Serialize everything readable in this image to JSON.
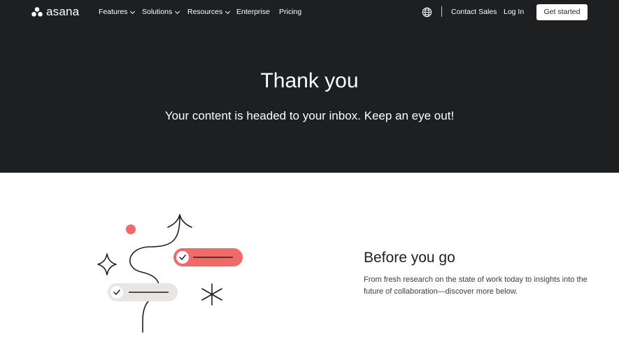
{
  "nav": {
    "logo_text": "asana",
    "features": "Features",
    "solutions": "Solutions",
    "resources": "Resources",
    "enterprise": "Enterprise",
    "pricing": "Pricing",
    "contact_sales": "Contact Sales",
    "log_in": "Log In",
    "get_started": "Get started"
  },
  "hero": {
    "title": "Thank you",
    "subtitle": "Your content is headed to your inbox. Keep an eye out!"
  },
  "before_you_go": {
    "title": "Before you go",
    "body": "From fresh research on the state of work today to insights into the future of collaboration—discover more below."
  },
  "colors": {
    "hero_bg": "#1e1f21",
    "accent_coral": "#f06a6a",
    "pill_grey": "#e8e6e4"
  },
  "icons": [
    "asana-logo-icon",
    "chevron-down-icon",
    "globe-icon",
    "check-icon",
    "sparkle-icon",
    "asterisk-icon",
    "arrow-up-icon"
  ]
}
